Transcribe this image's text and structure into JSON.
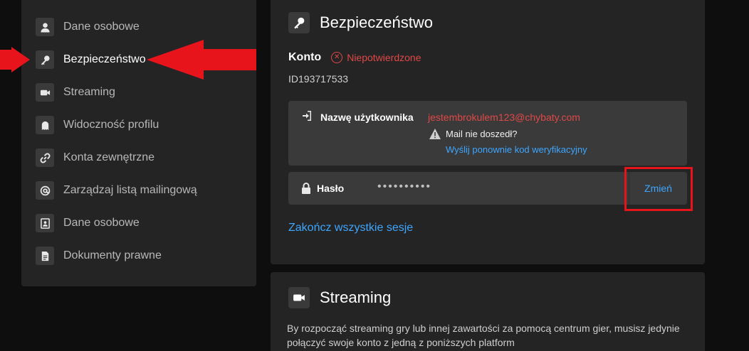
{
  "sidebar": {
    "items": [
      {
        "label": "Dane osobowe",
        "icon": "person-icon"
      },
      {
        "label": "Bezpieczeństwo",
        "icon": "key-icon",
        "active": true
      },
      {
        "label": "Streaming",
        "icon": "video-camera-icon"
      },
      {
        "label": "Widoczność profilu",
        "icon": "ghost-icon"
      },
      {
        "label": "Konta zewnętrzne",
        "icon": "link-icon"
      },
      {
        "label": "Zarządzaj listą mailingową",
        "icon": "at-sign-icon"
      },
      {
        "label": "Dane osobowe",
        "icon": "contact-card-icon"
      },
      {
        "label": "Dokumenty prawne",
        "icon": "document-icon"
      }
    ]
  },
  "security": {
    "title": "Bezpieczeństwo",
    "account_label": "Konto",
    "account_status": "Niepotwierdzone",
    "account_id": "ID193717533",
    "username_label": "Nazwę użytkownika",
    "email": "jestembrokulem123@chybaty.com",
    "mail_warning": "Mail nie doszedł?",
    "resend_link": "Wyślij ponownie kod weryfikacyjny",
    "password_label": "Hasło",
    "password_mask": "••••••••••",
    "change_button": "Zmień",
    "end_sessions": "Zakończ wszystkie sesje"
  },
  "streaming": {
    "title": "Streaming",
    "description": "By rozpocząć streaming gry lub innej zawartości za pomocą centrum gier, musisz jedynie połączyć swoje konto z jedną z poniższych platform"
  },
  "colors": {
    "panel_bg": "#242424",
    "box_bg": "#3a3a3a",
    "link": "#3ea6ff",
    "error": "#e04848",
    "annotation": "#e8141c"
  }
}
